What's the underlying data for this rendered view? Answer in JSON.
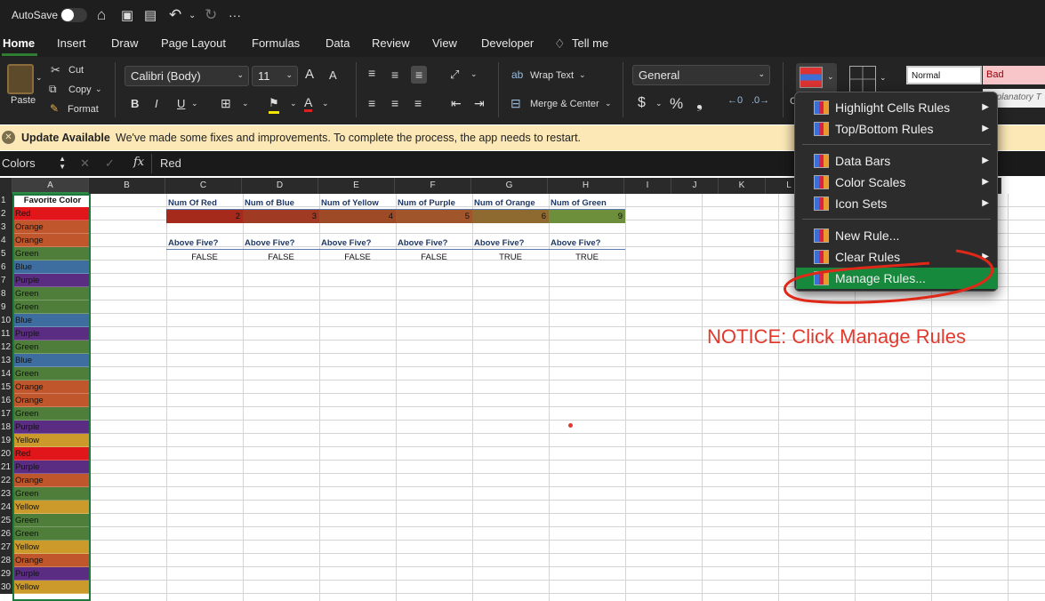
{
  "titlebar": {
    "autosave_label": "AutoSave",
    "more_label": "···"
  },
  "tabs": [
    {
      "label": "Home",
      "active": true
    },
    {
      "label": "Insert"
    },
    {
      "label": "Draw"
    },
    {
      "label": "Page Layout"
    },
    {
      "label": "Formulas"
    },
    {
      "label": "Data"
    },
    {
      "label": "Review"
    },
    {
      "label": "View"
    },
    {
      "label": "Developer"
    },
    {
      "label": "Tell me"
    }
  ],
  "ribbon": {
    "paste": "Paste",
    "cut": "Cut",
    "copy": "Copy",
    "format": "Format",
    "font_name": "Calibri (Body)",
    "font_size": "11",
    "bold": "B",
    "italic": "I",
    "underline": "U",
    "grow_font": "A",
    "shrink_font": "A",
    "wrap_text": "Wrap Text",
    "merge_center": "Merge & Center",
    "number_format": "General",
    "currency": "$",
    "percent": "%",
    "comma": "❟",
    "style_normal": "Normal",
    "style_bad": "Bad",
    "style_explanatory": "Explanatory T",
    "style_c": "C"
  },
  "notification": {
    "title": "Update Available",
    "message": "We've made some fixes and improvements. To complete the process, the app needs to restart."
  },
  "formula_bar": {
    "name_box": "Colors",
    "fx": "fx",
    "value": "Red"
  },
  "columns": [
    "A",
    "B",
    "C",
    "D",
    "E",
    "F",
    "G",
    "H",
    "I",
    "J",
    "K",
    "L",
    "",
    "",
    "",
    "Q"
  ],
  "rows": [
    "1",
    "2",
    "3",
    "4",
    "5",
    "6",
    "7",
    "8",
    "9",
    "10",
    "11",
    "12",
    "13",
    "14",
    "15",
    "16",
    "17",
    "18",
    "19",
    "20",
    "21",
    "22",
    "23",
    "24",
    "25",
    "26",
    "27",
    "28",
    "29",
    "30"
  ],
  "colA": {
    "header": "Favorite Color",
    "values": [
      "Red",
      "Orange",
      "Orange",
      "Green",
      "Blue",
      "Purple",
      "Green",
      "Green",
      "Blue",
      "Purple",
      "Green",
      "Blue",
      "Green",
      "Orange",
      "Orange",
      "Green",
      "Purple",
      "Yellow",
      "Red",
      "Purple",
      "Orange",
      "Green",
      "Yellow",
      "Green",
      "Green",
      "Yellow",
      "Orange",
      "Purple",
      "Yellow"
    ]
  },
  "summary": {
    "headers": [
      "Num Of Red",
      "Num of Blue",
      "Num of Yellow",
      "Num of Purple",
      "Num of Orange",
      "Num of Green"
    ],
    "values": [
      "2",
      "3",
      "4",
      "5",
      "6",
      "9"
    ],
    "above_label": "Above Five?",
    "above_values": [
      "FALSE",
      "FALSE",
      "FALSE",
      "FALSE",
      "TRUE",
      "TRUE"
    ]
  },
  "menu": {
    "items": [
      {
        "label": "Highlight Cells Rules",
        "submenu": true
      },
      {
        "label": "Top/Bottom Rules",
        "submenu": true
      },
      {
        "label": "Data Bars",
        "submenu": true
      },
      {
        "label": "Color Scales",
        "submenu": true
      },
      {
        "label": "Icon Sets",
        "submenu": true
      },
      {
        "label": "New Rule...",
        "submenu": false
      },
      {
        "label": "Clear Rules",
        "submenu": true
      },
      {
        "label": "Manage Rules...",
        "submenu": false,
        "highlighted": true
      }
    ]
  },
  "annotation": {
    "text": "NOTICE: Click Manage Rules",
    "color": "#e03a2e"
  },
  "colors": {
    "Red": "#e0161b",
    "Orange": "#c0562b",
    "Green": "#4e7e39",
    "Blue": "#3e6ea0",
    "Purple": "#5a2d82",
    "Yellow": "#cc9a2a",
    "accent": "#17893d"
  }
}
